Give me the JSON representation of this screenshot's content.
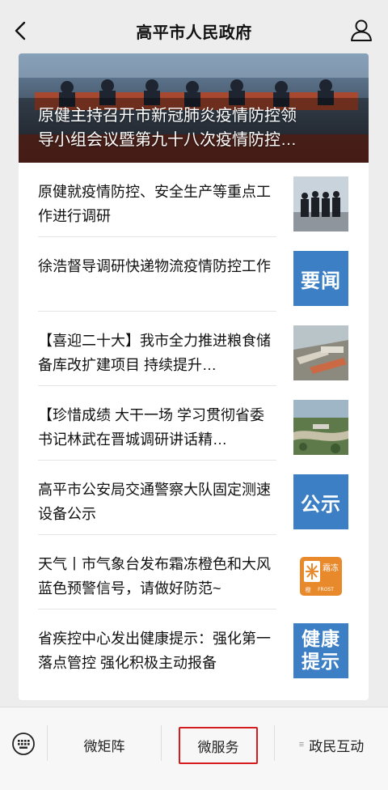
{
  "header": {
    "title": "高平市人民政府"
  },
  "hero": {
    "title": "原健主持召开市新冠肺炎疫情防控领\n导小组会议暨第九十八次疫情防控…"
  },
  "news": [
    {
      "text": "原健就疫情防控、安全生产等重点工作进行调研",
      "thumb": "photo-meeting"
    },
    {
      "text": "徐浩督导调研快递物流疫情防控工作",
      "thumb": "tag",
      "tag": "要闻"
    },
    {
      "text": "【喜迎二十大】我市全力推进粮食储备库改扩建项目 持续提升…",
      "thumb": "photo-warehouse"
    },
    {
      "text": "【珍惜成绩 大干一场 学习贯彻省委书记林武在晋城调研讲话精…",
      "thumb": "photo-aerial"
    },
    {
      "text": "高平市公安局交通警察大队固定测速设备公示",
      "thumb": "tag",
      "tag": "公示"
    },
    {
      "text": "天气丨市气象台发布霜冻橙色和大风蓝色预警信号，请做好防范~",
      "thumb": "frost",
      "frost": {
        "big": "霜冻",
        "small": "FROST",
        "mark": "橙"
      }
    },
    {
      "text": "省疾控中心发出健康提示：强化第一落点管控 强化积极主动报备",
      "thumb": "tag2",
      "tag_lines": [
        "健康",
        "提示"
      ]
    }
  ],
  "bottom_menu": {
    "item1": "微矩阵",
    "item2": "微服务",
    "item3": "政民互动"
  },
  "colors": {
    "tag_blue": "#3d7fc4",
    "highlight_red": "#d61c1c",
    "frost_orange": "#e8892b"
  }
}
